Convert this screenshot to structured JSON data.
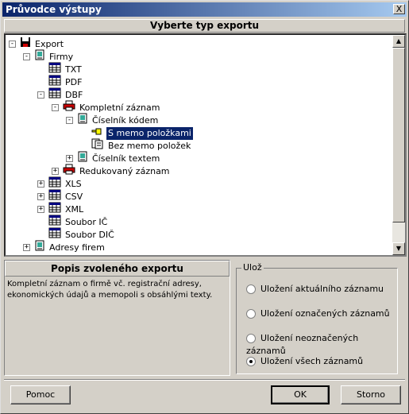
{
  "window": {
    "title": "Průvodce výstupy",
    "close_label": "X"
  },
  "header": {
    "title": "Vyberte typ exportu"
  },
  "tree": [
    {
      "label": "Export",
      "icon": "floppy-disk-icon",
      "expander": "-"
    },
    {
      "label": "Firmy",
      "icon": "document-icon",
      "expander": "-"
    },
    {
      "label": "TXT",
      "icon": "table-icon",
      "expander": ""
    },
    {
      "label": "PDF",
      "icon": "table-icon",
      "expander": ""
    },
    {
      "label": "DBF",
      "icon": "table-icon",
      "expander": "-"
    },
    {
      "label": "Kompletní záznam",
      "icon": "printer-icon",
      "expander": "-"
    },
    {
      "label": "Číselník kódem",
      "icon": "document-icon",
      "expander": "-"
    },
    {
      "label": "S memo položkami",
      "icon": "pointing-hand-icon",
      "expander": "",
      "selected": true
    },
    {
      "label": "Bez memo položek",
      "icon": "document-stack-icon",
      "expander": ""
    },
    {
      "label": "Číselník textem",
      "icon": "document-icon",
      "expander": "+"
    },
    {
      "label": "Redukovaný záznam",
      "icon": "printer-icon",
      "expander": "+"
    },
    {
      "label": "XLS",
      "icon": "table-icon",
      "expander": "+"
    },
    {
      "label": "CSV",
      "icon": "table-icon",
      "expander": "+"
    },
    {
      "label": "XML",
      "icon": "table-icon",
      "expander": "+"
    },
    {
      "label": "Soubor IČ",
      "icon": "table-icon",
      "expander": ""
    },
    {
      "label": "Soubor DIČ",
      "icon": "table-icon",
      "expander": ""
    },
    {
      "label": "Adresy firem",
      "icon": "document-icon",
      "expander": "+"
    }
  ],
  "description": {
    "title": "Popis zvoleného exportu",
    "text": "Kompletní záznam o firmě vč. registrační adresy, ekonomických údajů a memopoli s obsáhlými texty."
  },
  "save": {
    "legend": "Ulož",
    "options": [
      {
        "label": "Uložení aktuálního záznamu",
        "checked": false
      },
      {
        "label": "Uložení označených záznamů",
        "checked": false
      },
      {
        "label": "Uložení neoznačených záznamů",
        "checked": false
      },
      {
        "label": "Uložení všech záznamů",
        "checked": true
      }
    ]
  },
  "buttons": {
    "help": "Pomoc",
    "ok": "OK",
    "cancel": "Storno"
  }
}
